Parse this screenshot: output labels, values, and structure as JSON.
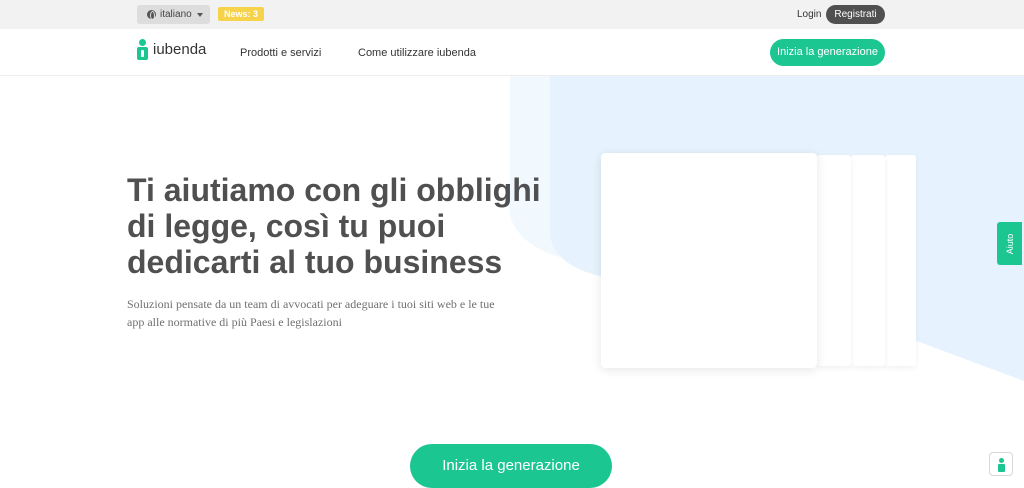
{
  "topbar": {
    "language": "italiano",
    "news": "News: 3",
    "login": "Login",
    "register": "Registrati"
  },
  "navbar": {
    "brand": "iubenda",
    "items": [
      "Prodotti e servizi",
      "Come utilizzare iubenda"
    ],
    "cta": "Inizia la generazione"
  },
  "hero": {
    "title": "Ti aiutiamo con gli obblighi di legge, così tu puoi dedicarti al tuo business",
    "subtitle": "Soluzioni pensate da un team di avvocati per adeguare i tuoi siti web e le tue app alle normative di più Paesi e legislazioni",
    "cta": "Inizia la generazione"
  },
  "side_tab": {
    "label": "Aiuto"
  },
  "colors": {
    "accent": "#1cc691",
    "news_badge": "#f7d34b",
    "hero_bg": "#e8f3fd",
    "dark_button": "#505050"
  }
}
